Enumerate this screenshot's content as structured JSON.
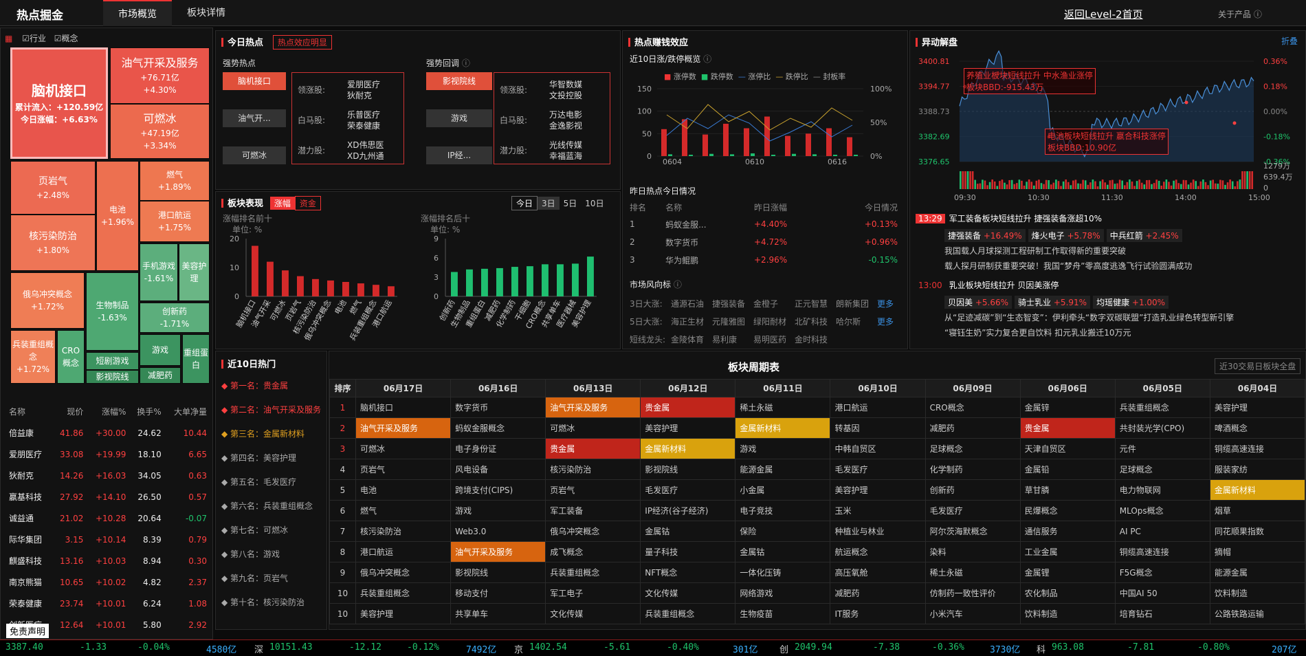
{
  "header": {
    "brand": "热点掘金",
    "tabs": [
      "市场概览",
      "板块详情"
    ],
    "back_link": "返回Level-2首页",
    "about": "关于产品"
  },
  "filters": {
    "industry": "行业",
    "concept": "概念"
  },
  "treemap": [
    {
      "name": "脑机接口",
      "inflow": "累计流入：+120.59亿",
      "change": "今日涨幅：+6.63%"
    },
    {
      "name": "油气开采及服务",
      "v1": "+76.71亿",
      "v2": "+4.30%"
    },
    {
      "name": "可燃冰",
      "v1": "+47.19亿",
      "v2": "+3.34%"
    },
    {
      "name": "页岩气",
      "v1": "+2.48%"
    },
    {
      "name": "电池",
      "v1": "+1.96%"
    },
    {
      "name": "燃气",
      "v1": "+1.89%"
    },
    {
      "name": "港口航运",
      "v1": "+1.75%"
    },
    {
      "name": "核污染防治",
      "v1": "+1.80%"
    },
    {
      "name": "俄乌冲突概念",
      "v1": "+1.72%"
    },
    {
      "name": "生物制品",
      "v1": "-1.63%"
    },
    {
      "name": "手机游戏",
      "v1": "-1.61%"
    },
    {
      "name": "美容护理",
      "v1": ""
    },
    {
      "name": "创新药",
      "v1": "-1.71%"
    },
    {
      "name": "兵装重组概念",
      "v1": "+1.72%"
    },
    {
      "name": "CRO概念",
      "v1": ""
    },
    {
      "name": "短剧游戏",
      "v1": ""
    },
    {
      "name": "游戏",
      "v1": ""
    },
    {
      "name": "重组蛋白",
      "v1": ""
    },
    {
      "name": "影视院线",
      "v1": ""
    },
    {
      "name": "减肥药",
      "v1": ""
    }
  ],
  "stock_list": {
    "headers": [
      "名称",
      "现价",
      "涨幅%",
      "换手%",
      "大单净量"
    ],
    "rows": [
      [
        "倍益康",
        "41.86",
        "+30.00",
        "24.62",
        "10.44"
      ],
      [
        "爱朋医疗",
        "33.08",
        "+19.99",
        "18.10",
        "6.65"
      ],
      [
        "狄耐克",
        "14.26",
        "+16.03",
        "34.05",
        "0.63"
      ],
      [
        "嬴基科技",
        "27.92",
        "+14.10",
        "26.50",
        "0.57"
      ],
      [
        "诚益通",
        "21.02",
        "+10.28",
        "20.64",
        "-0.07"
      ],
      [
        "际华集团",
        "3.15",
        "+10.14",
        "8.39",
        "0.79"
      ],
      [
        "麒盛科技",
        "13.16",
        "+10.03",
        "8.94",
        "0.30"
      ],
      [
        "南京熊猫",
        "10.65",
        "+10.02",
        "4.82",
        "2.37"
      ],
      [
        "荣泰健康",
        "23.74",
        "+10.01",
        "6.24",
        "1.08"
      ],
      [
        "创新医疗",
        "12.64",
        "+10.01",
        "5.80",
        "2.92"
      ]
    ],
    "disclaimer": "免责声明"
  },
  "today_hot": {
    "title": "今日热点",
    "badge": "热点效应明显",
    "strong_title": "强势热点",
    "pullback_title": "强势回调",
    "strong_btns": [
      "脑机接口",
      "油气开...",
      "可燃冰"
    ],
    "strong_detail": [
      [
        "领涨股:",
        "爱朋医疗",
        "狄耐克"
      ],
      [
        "白马股:",
        "乐普医疗",
        "荣泰健康"
      ],
      [
        "潜力股:",
        "XD伟思医",
        "XD九州通"
      ]
    ],
    "pull_btns": [
      "影视院线",
      "游戏",
      "IP经..."
    ],
    "pull_detail": [
      [
        "领涨股:",
        "华智数媒",
        "文投控股"
      ],
      [
        "白马股:",
        "万达电影",
        "金逸影视"
      ],
      [
        "潜力股:",
        "光线传媒",
        "幸福蓝海"
      ]
    ]
  },
  "profit": {
    "title": "热点赚钱效应",
    "sub": "近10日涨/跌停概览",
    "legend": [
      "涨停数",
      "跌停数",
      "涨停比",
      "跌停比",
      "封板率"
    ],
    "yaxis": [
      "150",
      "100",
      "50",
      "0"
    ],
    "yaxis_r": [
      "100%",
      "50%",
      "0%"
    ],
    "xaxis": [
      "0604",
      "0610",
      "0616"
    ]
  },
  "yesterday": {
    "title": "昨日热点今日情况",
    "headers": [
      "排名",
      "名称",
      "昨日涨幅",
      "今日情况"
    ],
    "rows": [
      [
        "1",
        "蚂蚁金服...",
        "+4.40%",
        "+0.13%"
      ],
      [
        "2",
        "数字货币",
        "+4.72%",
        "+0.96%"
      ],
      [
        "3",
        "华为鲲鹏",
        "+2.96%",
        "-0.15%"
      ]
    ]
  },
  "wind": {
    "title": "市场风向标",
    "more": "更多",
    "rows": [
      {
        "label": "3日大涨:",
        "items": [
          "通源石油",
          "捷强装备",
          "金橙子",
          "正元智慧",
          "朗新集团"
        ]
      },
      {
        "label": "5日大涨:",
        "items": [
          "海正生材",
          "元隆雅图",
          "绿阳耐材",
          "北矿科技",
          "哈尔斯"
        ]
      },
      {
        "label": "短线龙头:",
        "items": [
          "金陵体育",
          "易利康",
          "易明医药",
          "金时科技"
        ]
      }
    ]
  },
  "sector_perf": {
    "title": "板块表现",
    "tab1": "涨幅",
    "tab2": "资金",
    "periods": [
      "今日",
      "3日",
      "5日",
      "10日"
    ],
    "top_title": "涨幅排名前十",
    "bottom_title": "涨幅排名后十",
    "unit": "单位: %"
  },
  "abnormal": {
    "title": "异动解盘",
    "fold": "折叠",
    "yl": [
      "3400.81",
      "3394.77",
      "3388.73",
      "3382.69",
      "3376.65"
    ],
    "yr": [
      "0.36%",
      "0.18%",
      "0.00%",
      "-0.18%",
      "-0.36%"
    ],
    "vol": [
      "1279万",
      "639.4万",
      "0"
    ],
    "times": [
      "09:30",
      "10:30",
      "11:30",
      "14:00",
      "15:00"
    ],
    "anno1": [
      "养殖业板块短线拉升 中水渔业涨停",
      "板块BBD:-915.43万"
    ],
    "anno2": [
      "电池板块短线拉升 嬴合科技涨停",
      "板块BBD:10.90亿"
    ],
    "news": [
      {
        "time": "13:29",
        "title": "军工装备板块短线拉升 捷强装备涨超10%",
        "stocks": [
          [
            "捷强装备",
            "+16.49%"
          ],
          [
            "烽火电子",
            "+5.78%"
          ],
          [
            "中兵红箭",
            "+2.45%"
          ]
        ],
        "lines": [
          "我国载人月球探测工程研制工作取得新的重要突破",
          "载人探月研制获重要突破！我国“梦舟”零高度逃逸飞行试验圆满成功"
        ]
      },
      {
        "time": "13:00",
        "title": "乳业板块短线拉升 贝因美涨停",
        "stocks": [
          [
            "贝因美",
            "+5.66%"
          ],
          [
            "骑士乳业",
            "+5.91%"
          ],
          [
            "均瑶健康",
            "+1.00%"
          ]
        ],
        "lines": [
          "从“足迹减碳”到“生态智变”：伊利牵头“数字双碳联盟”打造乳业绿色转型新引擎",
          "“寝钰生奶”实力复合更自饮料 扣元乳业搬迁10万元"
        ]
      }
    ]
  },
  "hot10": {
    "title": "近10日热门",
    "items": [
      "◆ 第一名：贵金属",
      "◆ 第二名：油气开采及服务",
      "◆ 第三名：金属新材料",
      "◆ 第四名：美容护理",
      "◆ 第五名：毛发医疗",
      "◆ 第六名：兵装重组概念",
      "◆ 第七名：可燃冰",
      "◆ 第八名：游戏",
      "◆ 第九名：页岩气",
      "◆ 第十名：核污染防治"
    ]
  },
  "cycle": {
    "title": "板块周期表",
    "btn": "近30交易日板块全盘",
    "headers": [
      "排序",
      "06月17日",
      "06月16日",
      "06月13日",
      "06月12日",
      "06月11日",
      "06月10日",
      "06月09日",
      "06月06日",
      "06月05日",
      "06月04日"
    ],
    "rows": [
      [
        "1",
        "脑机接口",
        "数字货币",
        "油气开采及服务",
        "贵金属",
        "稀土永磁",
        "港口航运",
        "CRO概念",
        "金属锌",
        "兵装重组概念",
        "美容护理"
      ],
      [
        "2",
        "油气开采及服务",
        "蚂蚁金服概念",
        "可燃冰",
        "美容护理",
        "金属新材料",
        "转基因",
        "减肥药",
        "贵金属",
        "共封装光学(CPO)",
        "啤酒概念"
      ],
      [
        "3",
        "可燃冰",
        "电子身份证",
        "贵金属",
        "金属新材料",
        "游戏",
        "中韩自贸区",
        "足球概念",
        "天津自贸区",
        "元件",
        "铜缆高速连接"
      ],
      [
        "4",
        "页岩气",
        "风电设备",
        "核污染防治",
        "影视院线",
        "能源金属",
        "毛发医疗",
        "化学制药",
        "金属铅",
        "足球概念",
        "服装家纺"
      ],
      [
        "5",
        "电池",
        "跨境支付(CIPS)",
        "页岩气",
        "毛发医疗",
        "小金属",
        "美容护理",
        "创新药",
        "草甘膦",
        "电力物联网",
        "金属新材料"
      ],
      [
        "6",
        "燃气",
        "游戏",
        "军工装备",
        "IP经济(谷子经济)",
        "电子竞技",
        "玉米",
        "毛发医疗",
        "民爆概念",
        "MLOps概念",
        "烟草"
      ],
      [
        "7",
        "核污染防治",
        "Web3.0",
        "俄乌冲突概念",
        "金属钴",
        "保险",
        "种植业与林业",
        "阿尔茨海默概念",
        "通信服务",
        "AI PC",
        "同花顺果指数"
      ],
      [
        "8",
        "港口航运",
        "油气开采及服务",
        "成飞概念",
        "量子科技",
        "金属钴",
        "航运概念",
        "染料",
        "工业金属",
        "铜缆高速连接",
        "摘帽"
      ],
      [
        "9",
        "俄乌冲突概念",
        "影视院线",
        "兵装重组概念",
        "NFT概念",
        "一体化压铸",
        "高压氧舱",
        "稀土永磁",
        "金属锂",
        "F5G概念",
        "能源金属"
      ],
      [
        "10",
        "兵装重组概念",
        "移动支付",
        "军工电子",
        "文化传媒",
        "网络游戏",
        "减肥药",
        "仿制药一致性评价",
        "农化制品",
        "中国AI 50",
        "饮料制造"
      ],
      [
        "10",
        "美容护理",
        "共享单车",
        "文化传媒",
        "兵装重组概念",
        "生物疫苗",
        "IT服务",
        "小米汽车",
        "饮料制造",
        "培育钻石",
        "公路铁路运输"
      ]
    ]
  },
  "index_bar": [
    {
      "v": "3387.40",
      "c": "-1.33",
      "p": "-0.04%",
      "a": "4580亿"
    },
    {
      "n": "深",
      "v": "10151.43",
      "c": "-12.12",
      "p": "-0.12%",
      "a": "7492亿"
    },
    {
      "n": "京",
      "v": "1402.54",
      "c": "-5.61",
      "p": "-0.40%",
      "a": "301亿"
    },
    {
      "n": "创",
      "v": "2049.94",
      "c": "-7.38",
      "p": "-0.36%",
      "a": "3730亿"
    },
    {
      "n": "科",
      "v": "963.08",
      "c": "-7.81",
      "p": "-0.80%",
      "a": "207亿"
    }
  ],
  "chart_data": [
    {
      "type": "bar",
      "title": "涨幅排名前十",
      "categories": [
        "脑机接口",
        "油气开采",
        "可燃冰",
        "页岩气",
        "核污染防治",
        "俄乌冲突概念",
        "电池",
        "燃气",
        "兵装重组概念",
        "港口航运"
      ],
      "values": [
        17.5,
        12,
        9,
        7,
        6,
        5.5,
        5,
        4.5,
        4,
        3.5
      ],
      "ylim": [
        0,
        20
      ]
    },
    {
      "type": "bar",
      "title": "涨幅排名后十",
      "categories": [
        "创新药",
        "生物制品",
        "重组蛋白",
        "减肥药",
        "化学制药",
        "干细胞",
        "CRO概念",
        "共享单车",
        "医疗器械",
        "美容护理"
      ],
      "values": [
        3.8,
        4.2,
        4.3,
        4.4,
        4.6,
        4.7,
        5,
        5,
        5.1,
        6.2
      ],
      "ylim": [
        0,
        9
      ]
    },
    {
      "type": "bar",
      "title": "近10日涨/跌停概览",
      "categories": [
        "0604",
        "0605",
        "0606",
        "0609",
        "0610",
        "0611",
        "0612",
        "0613",
        "0616",
        "0617"
      ],
      "series": [
        {
          "name": "涨停数",
          "values": [
            60,
            82,
            48,
            72,
            62,
            88,
            45,
            50,
            62,
            42
          ]
        },
        {
          "name": "跌停数",
          "values": [
            4,
            3,
            5,
            4,
            6,
            3,
            5,
            4,
            3,
            3
          ]
        }
      ],
      "ylim": [
        0,
        150
      ]
    }
  ]
}
